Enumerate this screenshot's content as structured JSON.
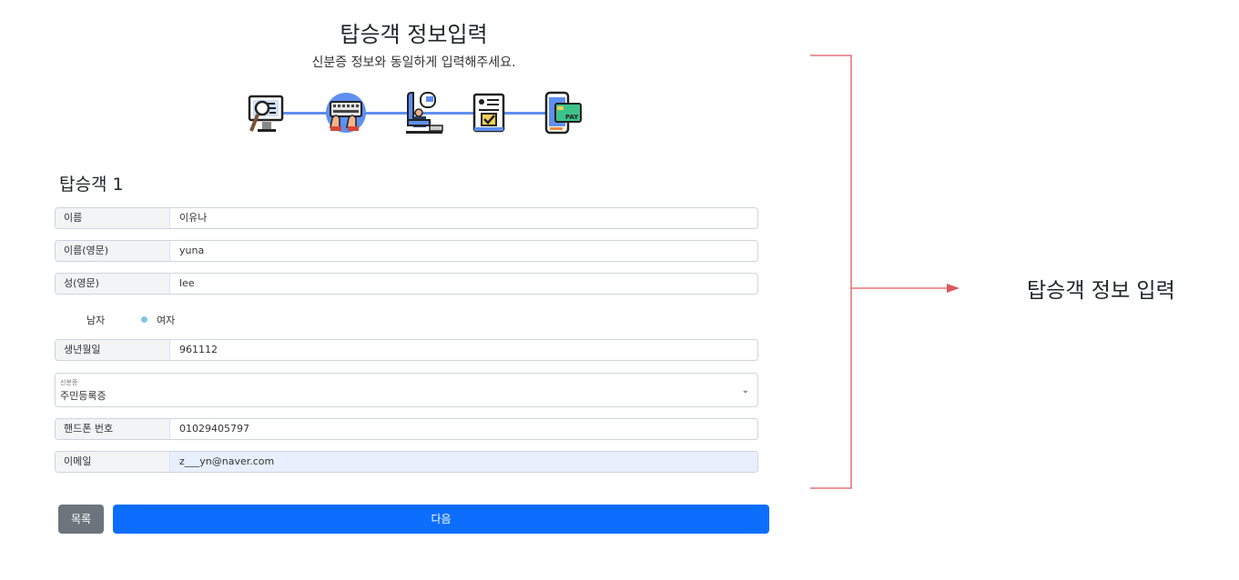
{
  "header": {
    "title": "탑승객 정보입력",
    "subtitle": "신분증 정보와 동일하게 입력해주세요."
  },
  "steps": [
    {
      "icon": "screen-search-icon",
      "active": false
    },
    {
      "icon": "keyboard-typing-icon",
      "active": true
    },
    {
      "icon": "airplane-seat-icon",
      "active": false
    },
    {
      "icon": "document-check-icon",
      "active": false
    },
    {
      "icon": "phone-pay-icon",
      "active": false
    }
  ],
  "passenger": {
    "section_title": "탑승객 1",
    "fields": {
      "name": {
        "label": "이름",
        "value": "이유나"
      },
      "name_en": {
        "label": "이름(영문)",
        "value": "yuna"
      },
      "surname_en": {
        "label": "성(영문)",
        "value": "lee"
      },
      "birth": {
        "label": "생년월일",
        "value": "961112"
      },
      "phone": {
        "label": "핸드폰 번호",
        "value": "01029405797"
      },
      "email": {
        "label": "이메일",
        "value": "z___yn@naver.com"
      }
    },
    "gender": {
      "male": "남자",
      "female": "여자",
      "selected": "여자"
    },
    "id_type": {
      "label": "신분증",
      "value": "주민등록증"
    }
  },
  "buttons": {
    "list": "목록",
    "next": "다음"
  },
  "annotation": {
    "text": "탑승객 정보 입력",
    "color": "#e0575b"
  },
  "colors": {
    "primary": "#0d6efd",
    "secondary": "#6c757d",
    "autofill": "#e8f0fe",
    "radio": "#7ec6e6"
  }
}
